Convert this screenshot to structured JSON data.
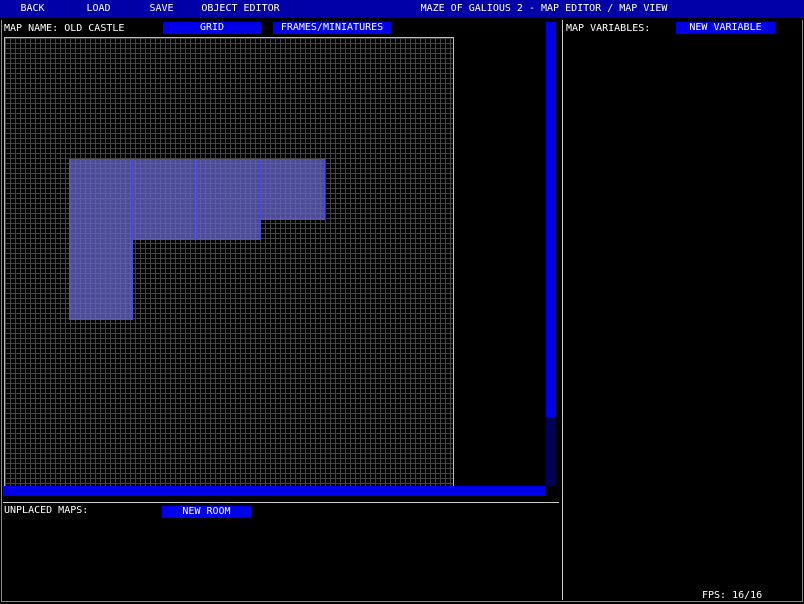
{
  "topbar": {
    "back_label": "BACK",
    "load_label": "LOAD",
    "save_label": "SAVE",
    "object_editor_label": "OBJECT EDITOR",
    "title": "MAZE OF GALIOUS 2 - MAP EDITOR / MAP VIEW"
  },
  "map": {
    "name_label": "MAP NAME: OLD CASTLE",
    "grid_label": "GRID",
    "frames_label": "FRAMES/MINIATURES"
  },
  "variables": {
    "label": "MAP VARIABLES:",
    "new_variable_label": "NEW VARIABLE"
  },
  "unplaced": {
    "label": "UNPLACED MAPS:",
    "new_room_label": "NEW ROOM"
  },
  "status": {
    "fps": "FPS: 16/16"
  },
  "colors": {
    "menu_bar": "#0000a8",
    "button": "#0000e8",
    "room_fill": "#6464c8",
    "room_border": "#4a4ae0"
  }
}
